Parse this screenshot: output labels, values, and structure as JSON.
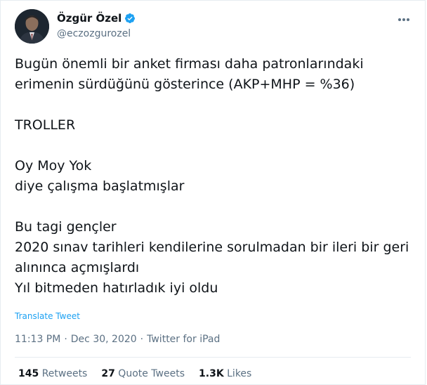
{
  "user": {
    "display_name": "Özgür Özel",
    "handle": "@eczozgurozel",
    "verified": true
  },
  "tweet": {
    "text": "Bugün önemli bir anket firması daha patronlarındaki erimenin sürdüğünü gösterince (AKP+MHP = %36)\n\nTROLLER\n\nOy Moy Yok\ndiye çalışma başlatmışlar\n\nBu tagi gençler\n2020 sınav tarihleri kendilerine sorulmadan bir ileri bir geri alınınca açmışlardı\nYıl bitmeden hatırladık iyi oldu",
    "translate_label": "Translate Tweet",
    "time": "11:13 PM",
    "separator": "·",
    "date": "Dec 30, 2020",
    "source": "Twitter for iPad"
  },
  "stats": {
    "retweets_count": "145",
    "retweets_label": "Retweets",
    "quotes_count": "27",
    "quotes_label": "Quote Tweets",
    "likes_count": "1.3K",
    "likes_label": "Likes"
  },
  "colors": {
    "link": "#1da1f2",
    "muted": "#5b7083",
    "text": "#0f1419",
    "border": "#e6ecf0"
  },
  "icons": {
    "verified": "verified-badge-icon",
    "more": "more-horizontal-icon"
  }
}
